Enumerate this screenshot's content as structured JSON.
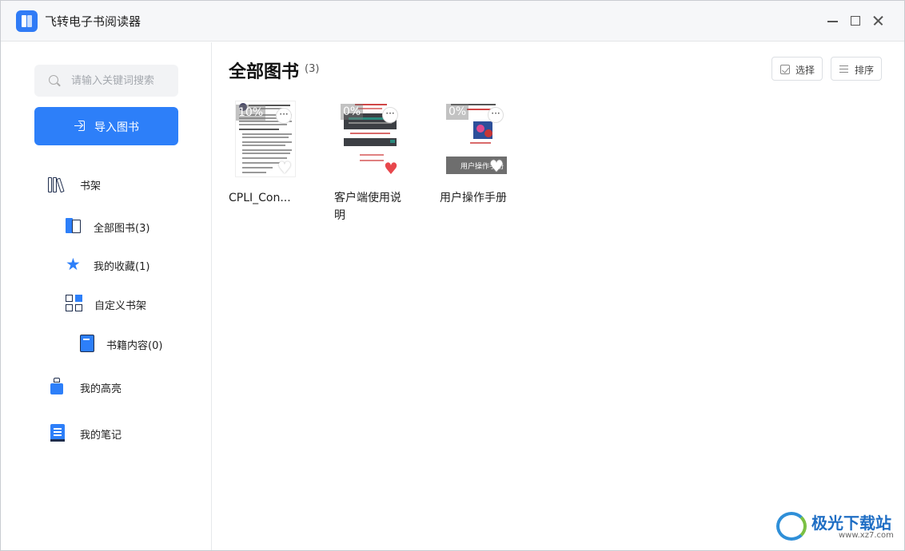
{
  "app": {
    "title": "飞转电子书阅读器"
  },
  "sidebar": {
    "search_placeholder": "请输入关键词搜索",
    "import_label": "导入图书",
    "items": [
      {
        "label": "书架",
        "icon": "bookshelf-icon"
      },
      {
        "label": "全部图书(3)",
        "icon": "all-books-icon"
      },
      {
        "label": "我的收藏(1)",
        "icon": "favorites-star-icon"
      },
      {
        "label": "自定义书架",
        "icon": "grid-icon"
      },
      {
        "label": "书籍内容(0)",
        "icon": "book-icon"
      },
      {
        "label": "我的高亮",
        "icon": "highlighter-icon"
      },
      {
        "label": "我的笔记",
        "icon": "notebook-icon"
      }
    ]
  },
  "main": {
    "title": "全部图书",
    "count": "(3)",
    "select_label": "选择",
    "sort_label": "排序",
    "books": [
      {
        "name": "CPLI_Con...",
        "progress": "10%",
        "favorite": false
      },
      {
        "name": "客户端使用说明",
        "progress": "0%",
        "favorite": true
      },
      {
        "name": "用户操作手册",
        "progress": "0%",
        "favorite": false
      }
    ],
    "cover3_caption": "用户操作手册"
  },
  "watermark": {
    "name": "极光下载站",
    "url": "www.xz7.com"
  },
  "colors": {
    "accent": "#2d7ff9",
    "favorite": "#e8474c",
    "icon_dark": "#1e2d4d"
  }
}
